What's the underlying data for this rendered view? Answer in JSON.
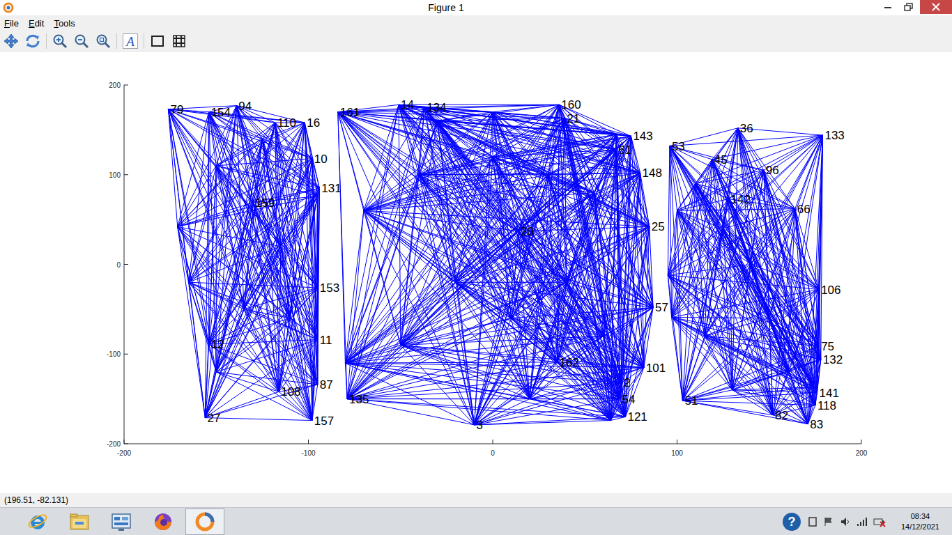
{
  "window": {
    "title": "Figure 1"
  },
  "menu": [
    "File",
    "Edit",
    "Tools"
  ],
  "toolbar": {
    "text_glyph": "A"
  },
  "chart": {
    "x_range": [
      -200,
      200
    ],
    "y_range": [
      -200,
      200
    ],
    "x_ticks": [
      "-200",
      "-100",
      "0",
      "100",
      "200"
    ],
    "y_ticks": [
      "200",
      "100",
      "0",
      "-100",
      "-200"
    ],
    "nodes": [
      {
        "label": "79",
        "x": -176,
        "y": 173,
        "cluster": "left"
      },
      {
        "label": "154",
        "x": -154,
        "y": 170,
        "cluster": "left"
      },
      {
        "label": "94",
        "x": -139,
        "y": 177,
        "cluster": "left"
      },
      {
        "label": "110",
        "x": -118,
        "y": 158,
        "cluster": "left"
      },
      {
        "label": "16",
        "x": -102,
        "y": 158,
        "cluster": "left"
      },
      {
        "label": "10",
        "x": -98,
        "y": 118,
        "cluster": "left"
      },
      {
        "label": "131",
        "x": -94,
        "y": 85,
        "cluster": "left"
      },
      {
        "label": "",
        "x": -95,
        "y": 76,
        "cluster": "left"
      },
      {
        "label": "159",
        "x": -130,
        "y": 69,
        "cluster": "left"
      },
      {
        "label": "153",
        "x": -95,
        "y": -26,
        "cluster": "left"
      },
      {
        "label": "11",
        "x": -95,
        "y": -84,
        "cluster": "left"
      },
      {
        "label": "12",
        "x": -154,
        "y": -89,
        "cluster": "left"
      },
      {
        "label": "87",
        "x": -95,
        "y": -134,
        "cluster": "left"
      },
      {
        "label": "108",
        "x": -116,
        "y": -142,
        "cluster": "left"
      },
      {
        "label": "27",
        "x": -156,
        "y": -171,
        "cluster": "left"
      },
      {
        "label": "157",
        "x": -98,
        "y": -174,
        "cluster": "left"
      },
      {
        "label": "",
        "x": -171,
        "y": 42,
        "cluster": "left"
      },
      {
        "label": "",
        "x": -165,
        "y": -20,
        "cluster": "left"
      },
      {
        "label": "",
        "x": -150,
        "y": 110,
        "cluster": "left"
      },
      {
        "label": "",
        "x": -125,
        "y": 140,
        "cluster": "left"
      },
      {
        "label": "",
        "x": -115,
        "y": 20,
        "cluster": "left"
      },
      {
        "label": "",
        "x": -135,
        "y": -50,
        "cluster": "left"
      },
      {
        "label": "",
        "x": -110,
        "y": -60,
        "cluster": "left"
      },
      {
        "label": "",
        "x": -150,
        "y": -120,
        "cluster": "left"
      },
      {
        "label": "161",
        "x": -84,
        "y": 170,
        "cluster": "middle"
      },
      {
        "label": "14",
        "x": -51,
        "y": 178,
        "cluster": "middle"
      },
      {
        "label": "134",
        "x": -37,
        "y": 175,
        "cluster": "middle"
      },
      {
        "label": "160",
        "x": 36,
        "y": 178,
        "cluster": "middle"
      },
      {
        "label": "21",
        "x": 39,
        "y": 163,
        "cluster": "middle"
      },
      {
        "label": "",
        "x": 67,
        "y": 145,
        "cluster": "middle"
      },
      {
        "label": "143",
        "x": 75,
        "y": 143,
        "cluster": "middle"
      },
      {
        "label": "61",
        "x": 67,
        "y": 128,
        "cluster": "middle"
      },
      {
        "label": "148",
        "x": 80,
        "y": 102,
        "cluster": "middle"
      },
      {
        "label": "25",
        "x": 85,
        "y": 42,
        "cluster": "middle"
      },
      {
        "label": "57",
        "x": 87,
        "y": -48,
        "cluster": "middle"
      },
      {
        "label": "101",
        "x": 82,
        "y": -115,
        "cluster": "middle"
      },
      {
        "label": "162",
        "x": 35,
        "y": -109,
        "cluster": "middle"
      },
      {
        "label": "2",
        "x": 70,
        "y": -132,
        "cluster": "middle"
      },
      {
        "label": "54",
        "x": 69,
        "y": -150,
        "cluster": "middle"
      },
      {
        "label": "121",
        "x": 72,
        "y": -170,
        "cluster": "middle"
      },
      {
        "label": "",
        "x": 64,
        "y": -174,
        "cluster": "middle"
      },
      {
        "label": "3",
        "x": -10,
        "y": -179,
        "cluster": "middle"
      },
      {
        "label": "135",
        "x": -79,
        "y": -150,
        "cluster": "middle"
      },
      {
        "label": "20",
        "x": 14,
        "y": 37,
        "cluster": "middle"
      },
      {
        "label": "",
        "x": -80,
        "y": -110,
        "cluster": "middle"
      },
      {
        "label": "",
        "x": -70,
        "y": 60,
        "cluster": "middle"
      },
      {
        "label": "",
        "x": -40,
        "y": 100,
        "cluster": "middle"
      },
      {
        "label": "",
        "x": 0,
        "y": 120,
        "cluster": "middle"
      },
      {
        "label": "",
        "x": 30,
        "y": 100,
        "cluster": "middle"
      },
      {
        "label": "",
        "x": -20,
        "y": -20,
        "cluster": "middle"
      },
      {
        "label": "",
        "x": 10,
        "y": -60,
        "cluster": "middle"
      },
      {
        "label": "",
        "x": 40,
        "y": -20,
        "cluster": "middle"
      },
      {
        "label": "",
        "x": -50,
        "y": -90,
        "cluster": "middle"
      },
      {
        "label": "",
        "x": 20,
        "y": -150,
        "cluster": "middle"
      },
      {
        "label": "",
        "x": 55,
        "y": 80,
        "cluster": "middle"
      },
      {
        "label": "",
        "x": 60,
        "y": -80,
        "cluster": "middle"
      },
      {
        "label": "",
        "x": -30,
        "y": 160,
        "cluster": "middle"
      },
      {
        "label": "",
        "x": 0,
        "y": 170,
        "cluster": "middle"
      },
      {
        "label": "53",
        "x": 96,
        "y": 132,
        "cluster": "right"
      },
      {
        "label": "36",
        "x": 133,
        "y": 152,
        "cluster": "right"
      },
      {
        "label": "133",
        "x": 179,
        "y": 144,
        "cluster": "right"
      },
      {
        "label": "45",
        "x": 119,
        "y": 117,
        "cluster": "right"
      },
      {
        "label": "96",
        "x": 147,
        "y": 105,
        "cluster": "right"
      },
      {
        "label": "142",
        "x": 128,
        "y": 73,
        "cluster": "right"
      },
      {
        "label": "66",
        "x": 164,
        "y": 62,
        "cluster": "right"
      },
      {
        "label": "106",
        "x": 177,
        "y": -28,
        "cluster": "right"
      },
      {
        "label": "75",
        "x": 177,
        "y": -91,
        "cluster": "right"
      },
      {
        "label": "132",
        "x": 178,
        "y": -106,
        "cluster": "right"
      },
      {
        "label": "",
        "x": 174,
        "y": -137,
        "cluster": "right"
      },
      {
        "label": "141",
        "x": 176,
        "y": -143,
        "cluster": "right"
      },
      {
        "label": "118",
        "x": 175,
        "y": -157,
        "cluster": "right"
      },
      {
        "label": "83",
        "x": 171,
        "y": -178,
        "cluster": "right"
      },
      {
        "label": "82",
        "x": 152,
        "y": -168,
        "cluster": "right"
      },
      {
        "label": "51",
        "x": 103,
        "y": -152,
        "cluster": "right"
      },
      {
        "label": "",
        "x": 95,
        "y": -12,
        "cluster": "right"
      },
      {
        "label": "",
        "x": 97,
        "y": -59,
        "cluster": "right"
      },
      {
        "label": "",
        "x": 110,
        "y": 90,
        "cluster": "right"
      },
      {
        "label": "",
        "x": 125,
        "y": 40,
        "cluster": "right"
      },
      {
        "label": "",
        "x": 140,
        "y": 0,
        "cluster": "right"
      },
      {
        "label": "",
        "x": 115,
        "y": -80,
        "cluster": "right"
      },
      {
        "label": "",
        "x": 150,
        "y": -60,
        "cluster": "right"
      },
      {
        "label": "",
        "x": 130,
        "y": -140,
        "cluster": "right"
      },
      {
        "label": "",
        "x": 160,
        "y": -120,
        "cluster": "right"
      },
      {
        "label": "",
        "x": 100,
        "y": 60,
        "cluster": "right"
      }
    ]
  },
  "status_bar": {
    "text": "(196.51, -82.131)"
  },
  "taskbar": {
    "apps": [
      {
        "kind": "ie",
        "selected": false
      },
      {
        "kind": "explorer",
        "selected": false
      },
      {
        "kind": "control",
        "selected": false
      },
      {
        "kind": "firefox",
        "selected": false
      },
      {
        "kind": "octave",
        "selected": true
      }
    ],
    "help_glyph": "?",
    "time": "08:34",
    "date": "14/12/2021"
  }
}
